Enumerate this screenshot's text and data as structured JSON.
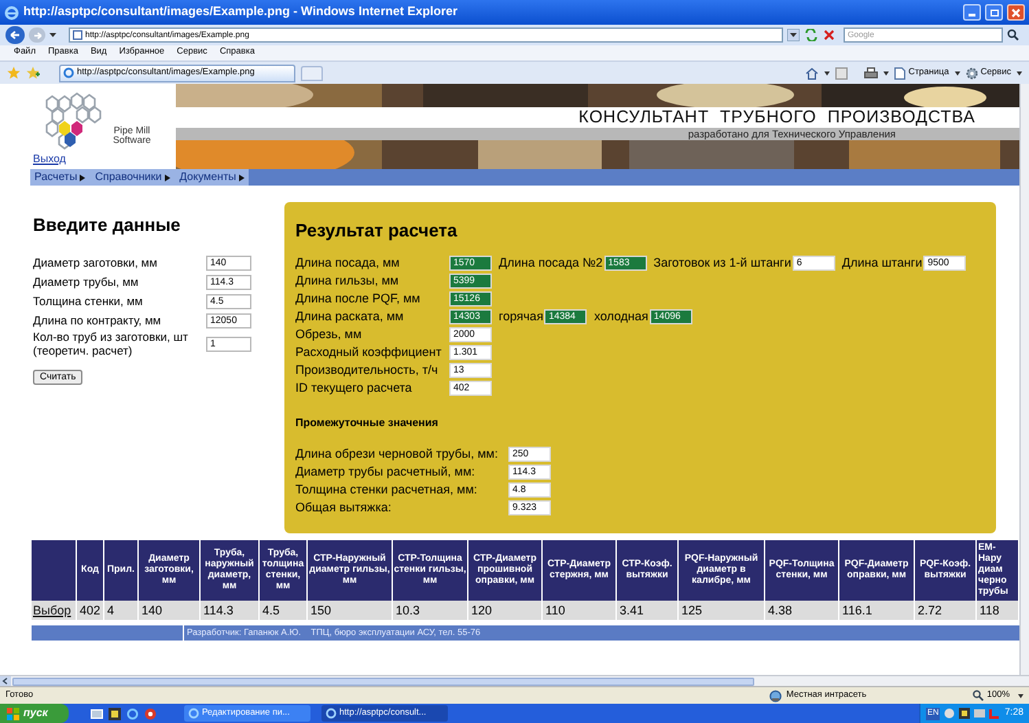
{
  "window": {
    "title": "http://asptpc/consultant/images/Example.png - Windows Internet Explorer"
  },
  "address_bar": {
    "url": "http://asptpc/consultant/images/Example.png"
  },
  "search": {
    "placeholder": "Google"
  },
  "menu": [
    "Файл",
    "Правка",
    "Вид",
    "Избранное",
    "Сервис",
    "Справка"
  ],
  "tab": {
    "title": "http://asptpc/consultant/images/Example.png"
  },
  "toolbar": [
    "Страница",
    "Сервис"
  ],
  "header": {
    "logo_text": "Pipe Mill Software",
    "title": "КОНСУЛЬТАНТ  ТРУБНОГО  ПРОИЗВОДСТВА",
    "subtitle": "разработано для Технического Управления"
  },
  "logout_link": "Выход",
  "nav": [
    "Расчеты",
    "Справочники",
    "Документы"
  ],
  "input_panel": {
    "title": "Введите данные",
    "fields": [
      {
        "label": "Диаметр заготовки, мм",
        "value": "140"
      },
      {
        "label": "Диаметр трубы, мм",
        "value": "114.3"
      },
      {
        "label": "Толщина стенки, мм",
        "value": "4.5"
      },
      {
        "label": "Длина по контракту, мм",
        "value": "12050"
      },
      {
        "label": "Кол-во труб из заготовки, шт (теоретич. расчет)",
        "value": "1"
      }
    ],
    "button": "Считать"
  },
  "result_panel": {
    "title": "Результат расчета",
    "rows": [
      {
        "fields": [
          {
            "label": "Длина посада, мм",
            "value": "1570",
            "highlighted": true
          },
          {
            "label": "Длина посада №2",
            "value": "1583",
            "highlighted": true
          },
          {
            "label": "Заготовок из 1-й штанги",
            "value": "6",
            "highlighted": false
          },
          {
            "label": "Длина штанги",
            "value": "9500",
            "highlighted": false
          }
        ]
      },
      {
        "fields": [
          {
            "label": "Длина гильзы, мм",
            "value": "5399",
            "highlighted": true
          }
        ]
      },
      {
        "fields": [
          {
            "label": "Длина после PQF, мм",
            "value": "15126",
            "highlighted": true
          }
        ]
      },
      {
        "fields": [
          {
            "label": "Длина раската, мм",
            "value": "14303",
            "highlighted": true
          },
          {
            "label": "горячая",
            "value": "14384",
            "highlighted": true
          },
          {
            "label": "холодная",
            "value": "14096",
            "highlighted": true
          }
        ]
      },
      {
        "fields": [
          {
            "label": "Обрезь, мм",
            "value": "2000",
            "highlighted": false
          }
        ]
      },
      {
        "fields": [
          {
            "label": "Расходный коэффициент",
            "value": "1.301",
            "highlighted": false
          }
        ]
      },
      {
        "fields": [
          {
            "label": "Производительность, т/ч",
            "value": "13",
            "highlighted": false
          }
        ]
      },
      {
        "fields": [
          {
            "label": "ID текущего расчета",
            "value": "402",
            "highlighted": false
          }
        ]
      }
    ],
    "subtitle": "Промежуточные значения",
    "intermediate": [
      {
        "label": "Длина обрези черновой трубы, мм:",
        "value": "250"
      },
      {
        "label": "Диаметр трубы расчетный, мм:",
        "value": "114.3"
      },
      {
        "label": "Толщина стенки расчетная, мм:",
        "value": "4.8"
      },
      {
        "label": "Общая вытяжка:",
        "value": "9.323"
      }
    ]
  },
  "table": {
    "columns": [
      "Код",
      "Прил.",
      "Диаметр заготовки, мм",
      "Труба, наружный диаметр, мм",
      "Труба, толщина стенки, мм",
      "СТР-Наружный диаметр гильзы, мм",
      "СТР-Толщина стенки гильзы, мм",
      "СТР-Диаметр прошивной оправки, мм",
      "СТР-Диаметр стержня, мм",
      "СТР-Коэф. вытяжки",
      "PQF-Наружный диаметр в калибре, мм",
      "PQF-Толщина стенки, мм",
      "PQF-Диаметр оправки, мм",
      "PQF-Коэф. вытяжки",
      "EM-Нару диам черно трубы"
    ],
    "rows": [
      {
        "link": "Выбор",
        "cells": [
          "402",
          "4",
          "140",
          "114.3",
          "4.5",
          "150",
          "10.3",
          "120",
          "110",
          "3.41",
          "125",
          "4.38",
          "116.1",
          "2.72",
          "118"
        ]
      }
    ]
  },
  "footer": "Разработчик: Гапанюк А.Ю.    ТПЦ, бюро эксплуатации АСУ, тел. 55-76",
  "status_bar": {
    "text": "Готово",
    "zone": "Местная интрасеть",
    "zoom": "100%"
  },
  "taskbar": {
    "start": "пуск",
    "tasks": [
      {
        "title": "Редактирование пи...",
        "selected": false
      },
      {
        "title": "http://asptpc/consult...",
        "selected": true
      }
    ],
    "language": "EN",
    "clock": "7:28"
  }
}
